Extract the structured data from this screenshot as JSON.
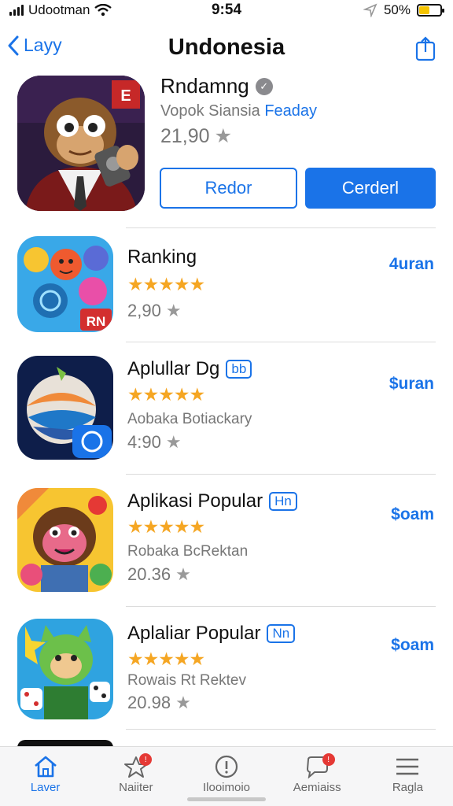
{
  "status_bar": {
    "carrier": "Udootman",
    "time": "9:54",
    "battery": "50%",
    "battery_level": 0.5
  },
  "nav": {
    "back_label": "Layy",
    "title": "Undonesia"
  },
  "hero": {
    "name": "Rndamng",
    "subtitle_gray": "Vopok Siansia",
    "subtitle_accent": "Feaday",
    "rating": "21,90",
    "button_outline": "Redor",
    "button_fill": "Cerderl"
  },
  "apps": [
    {
      "name": "Ranking",
      "tag": "",
      "stars": "★★★★★",
      "subtitle": "",
      "rating": "2,90",
      "price": "4uran"
    },
    {
      "name": "Aplullar Dg",
      "tag": "bb",
      "stars": "★★★★★",
      "subtitle": "Aobaka Botiackary",
      "rating": "4:90",
      "price": "$uran"
    },
    {
      "name": "Aplikasi Popular",
      "tag": "Hn",
      "stars": "★★★★★",
      "subtitle": "Robaka BcRektan",
      "rating": "20.36",
      "price": "$oam"
    },
    {
      "name": "Aplaliar Popular",
      "tag": "Nn",
      "stars": "★★★★★",
      "subtitle": "Rowais Rt Rektev",
      "rating": "20.98",
      "price": "$oam"
    }
  ],
  "tabs": [
    {
      "label": "Laver",
      "icon": "home-icon"
    },
    {
      "label": "Naiiter",
      "icon": "star-icon"
    },
    {
      "label": "Ilooimoio",
      "icon": "info-icon"
    },
    {
      "label": "Aemiaiss",
      "icon": "chat-icon"
    },
    {
      "label": "Ragla",
      "icon": "menu-icon"
    }
  ],
  "colors": {
    "accent": "#1a73e8",
    "star": "#f5a623",
    "badge": "#e53935"
  }
}
